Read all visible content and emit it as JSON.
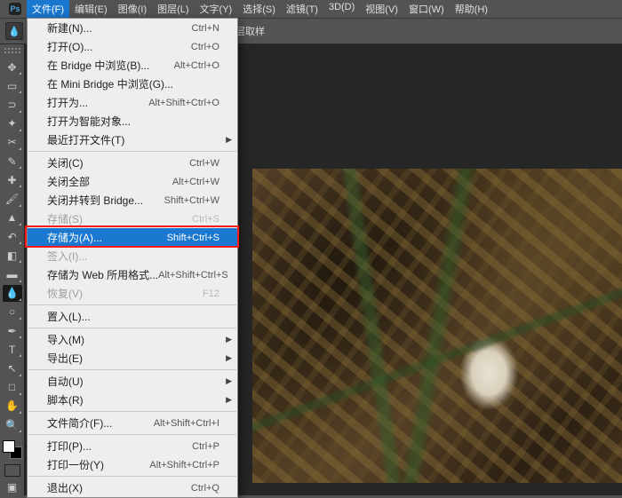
{
  "menubar": {
    "items": [
      "文件(F)",
      "编辑(E)",
      "图像(I)",
      "图层(L)",
      "文字(Y)",
      "选择(S)",
      "滤镜(T)",
      "3D(D)",
      "视图(V)",
      "窗口(W)",
      "帮助(H)"
    ],
    "active_index": 0
  },
  "options_bar": {
    "sample_all_label": "对所有图层取样"
  },
  "dropdown": {
    "groups": [
      [
        {
          "label": "新建(N)...",
          "shortcut": "Ctrl+N",
          "enabled": true
        },
        {
          "label": "打开(O)...",
          "shortcut": "Ctrl+O",
          "enabled": true
        },
        {
          "label": "在 Bridge 中浏览(B)...",
          "shortcut": "Alt+Ctrl+O",
          "enabled": true
        },
        {
          "label": "在 Mini Bridge 中浏览(G)...",
          "shortcut": "",
          "enabled": true
        },
        {
          "label": "打开为...",
          "shortcut": "Alt+Shift+Ctrl+O",
          "enabled": true
        },
        {
          "label": "打开为智能对象...",
          "shortcut": "",
          "enabled": true
        },
        {
          "label": "最近打开文件(T)",
          "shortcut": "",
          "enabled": true,
          "submenu": true
        }
      ],
      [
        {
          "label": "关闭(C)",
          "shortcut": "Ctrl+W",
          "enabled": true
        },
        {
          "label": "关闭全部",
          "shortcut": "Alt+Ctrl+W",
          "enabled": true
        },
        {
          "label": "关闭并转到 Bridge...",
          "shortcut": "Shift+Ctrl+W",
          "enabled": true
        },
        {
          "label": "存储(S)",
          "shortcut": "Ctrl+S",
          "enabled": false
        },
        {
          "label": "存储为(A)...",
          "shortcut": "Shift+Ctrl+S",
          "enabled": true,
          "highlight": true
        },
        {
          "label": "签入(I)...",
          "shortcut": "",
          "enabled": false
        },
        {
          "label": "存储为 Web 所用格式...",
          "shortcut": "Alt+Shift+Ctrl+S",
          "enabled": true
        },
        {
          "label": "恢复(V)",
          "shortcut": "F12",
          "enabled": false
        }
      ],
      [
        {
          "label": "置入(L)...",
          "shortcut": "",
          "enabled": true
        }
      ],
      [
        {
          "label": "导入(M)",
          "shortcut": "",
          "enabled": true,
          "submenu": true
        },
        {
          "label": "导出(E)",
          "shortcut": "",
          "enabled": true,
          "submenu": true
        }
      ],
      [
        {
          "label": "自动(U)",
          "shortcut": "",
          "enabled": true,
          "submenu": true
        },
        {
          "label": "脚本(R)",
          "shortcut": "",
          "enabled": true,
          "submenu": true
        }
      ],
      [
        {
          "label": "文件简介(F)...",
          "shortcut": "Alt+Shift+Ctrl+I",
          "enabled": true
        }
      ],
      [
        {
          "label": "打印(P)...",
          "shortcut": "Ctrl+P",
          "enabled": true
        },
        {
          "label": "打印一份(Y)",
          "shortcut": "Alt+Shift+Ctrl+P",
          "enabled": true
        }
      ],
      [
        {
          "label": "退出(X)",
          "shortcut": "Ctrl+Q",
          "enabled": true
        }
      ]
    ]
  },
  "tools": [
    {
      "name": "move-tool",
      "glyph": "✥"
    },
    {
      "name": "marquee-tool",
      "glyph": "▭"
    },
    {
      "name": "lasso-tool",
      "glyph": "⊃"
    },
    {
      "name": "magic-wand-tool",
      "glyph": "✦"
    },
    {
      "name": "crop-tool",
      "glyph": "✂"
    },
    {
      "name": "eyedropper-tool",
      "glyph": "✎"
    },
    {
      "name": "healing-brush-tool",
      "glyph": "✚"
    },
    {
      "name": "brush-tool",
      "glyph": "🖌"
    },
    {
      "name": "clone-stamp-tool",
      "glyph": "▲"
    },
    {
      "name": "history-brush-tool",
      "glyph": "↶"
    },
    {
      "name": "eraser-tool",
      "glyph": "◧"
    },
    {
      "name": "gradient-tool",
      "glyph": "▬"
    },
    {
      "name": "blur-tool",
      "glyph": "💧",
      "selected": true
    },
    {
      "name": "dodge-tool",
      "glyph": "○"
    },
    {
      "name": "pen-tool",
      "glyph": "✒"
    },
    {
      "name": "type-tool",
      "glyph": "T"
    },
    {
      "name": "path-selection-tool",
      "glyph": "↖"
    },
    {
      "name": "rectangle-tool",
      "glyph": "□"
    },
    {
      "name": "hand-tool",
      "glyph": "✋"
    },
    {
      "name": "zoom-tool",
      "glyph": "🔍"
    }
  ],
  "colors": {
    "highlight": "#1a78d0",
    "red_box": "#ff1a1a"
  }
}
